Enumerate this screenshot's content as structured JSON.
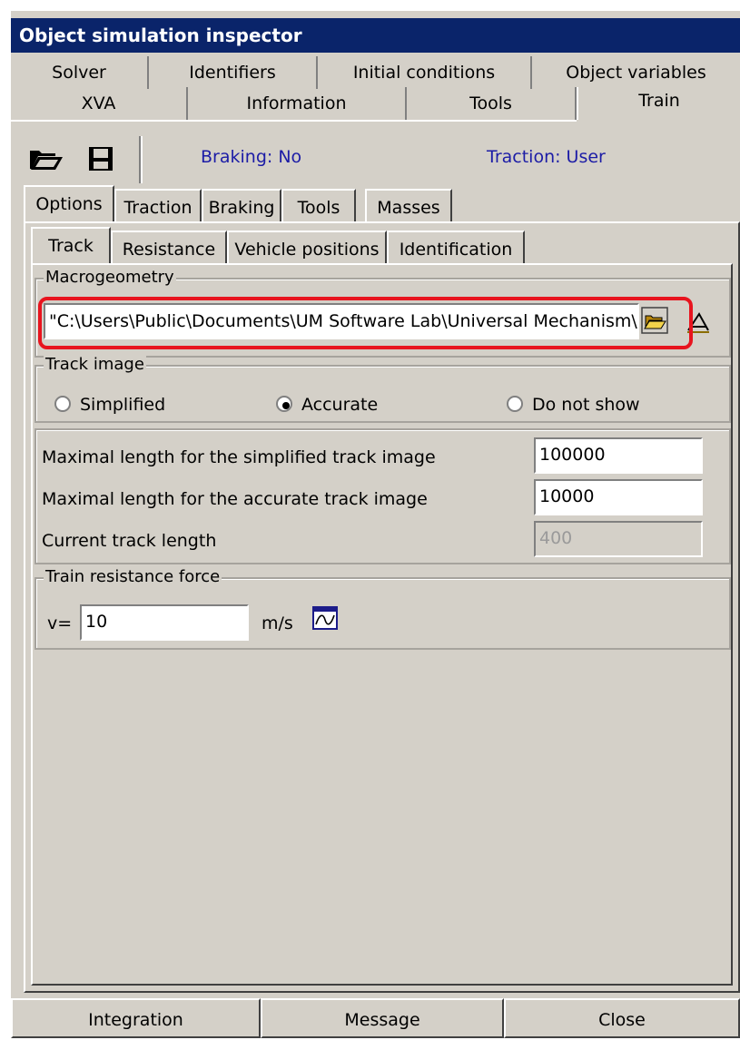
{
  "window": {
    "title": "Object simulation inspector"
  },
  "top_tabs": {
    "row1": [
      "Solver",
      "Identifiers",
      "Initial conditions",
      "Object variables"
    ],
    "row2": [
      "XVA",
      "Information",
      "Tools",
      "Train"
    ],
    "active": "Train"
  },
  "toolbar": {
    "open_icon": "folder-open-icon",
    "save_icon": "floppy-disk-icon",
    "braking_status": "Braking: No",
    "traction_status": "Traction: User"
  },
  "sub_tabs": {
    "items": [
      "Options",
      "Traction",
      "Braking",
      "Tools",
      "Masses"
    ],
    "active": "Options"
  },
  "inner_tabs": {
    "items": [
      "Track",
      "Resistance",
      "Vehicle positions",
      "Identification"
    ],
    "active": "Track"
  },
  "macrogeometry": {
    "title": "Macrogeometry",
    "path": "\"C:\\Users\\Public\\Documents\\UM Software Lab\\Universal Mechanism\\",
    "browse_icon": "folder-open-icon",
    "tool_icon": "track-geometry-icon"
  },
  "track_image": {
    "title": "Track image",
    "options": [
      "Simplified",
      "Accurate",
      "Do not show"
    ],
    "selected": "Accurate"
  },
  "lengths": {
    "simplified_label": "Maximal length for the simplified track image",
    "simplified_value": "100000",
    "accurate_label": "Maximal length for the accurate track image",
    "accurate_value": "10000",
    "current_label": "Current track length",
    "current_value": "400"
  },
  "resistance": {
    "title": "Train resistance force",
    "v_label": "v=",
    "v_value": "10",
    "unit": "m/s",
    "plot_icon": "graph-icon"
  },
  "bottom_buttons": [
    "Integration",
    "Message",
    "Close"
  ],
  "colors": {
    "title_bg": "#0a246a",
    "status_text": "#1c1ca6",
    "highlight": "#e8141e",
    "face": "#d4d0c8"
  }
}
